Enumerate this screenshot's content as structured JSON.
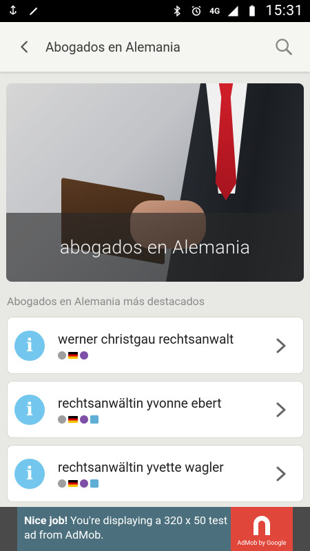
{
  "status_bar": {
    "time": "15:31",
    "network": "4G",
    "icons": [
      "usb-icon",
      "edit-icon",
      "bluetooth-icon",
      "alarm-icon",
      "signal-icon",
      "battery-icon"
    ]
  },
  "app_bar": {
    "title": "Abogados en Alemania"
  },
  "hero": {
    "caption": "abogados en Alemania"
  },
  "section": {
    "header": "Abogados en Alemania más destacados"
  },
  "cards": [
    {
      "name": "werner christgau rechtsanwalt",
      "badges": [
        "rating",
        "germany-flag",
        "viber"
      ]
    },
    {
      "name": "rechtsanwältin yvonne ebert",
      "badges": [
        "rating",
        "germany-flag",
        "viber",
        "phone"
      ]
    },
    {
      "name": "rechtsanwältin yvette wagler",
      "badges": [
        "rating",
        "germany-flag",
        "viber",
        "phone"
      ]
    }
  ],
  "ad": {
    "highlight": "Nice job!",
    "text": " You're displaying a 320 x 50 test ad from AdMob.",
    "brand": "AdMob by Google"
  },
  "colors": {
    "accent_info": "#73c6ee",
    "ad_background": "#4b6f7d",
    "ad_brand": "#e0473a"
  }
}
